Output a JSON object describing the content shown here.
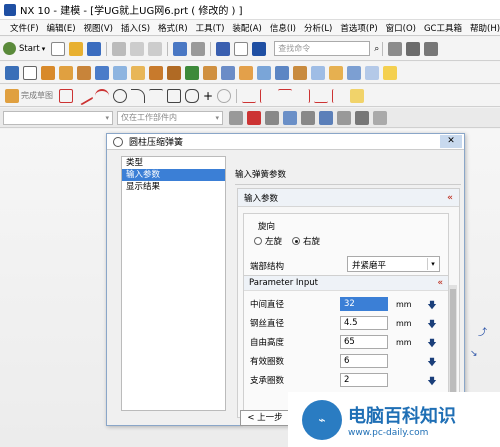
{
  "window": {
    "title": "NX 10 - 建模 - [学UG就上UG网6.prt  ( 修改的 ) ]"
  },
  "menu": {
    "items": [
      "文件(F)",
      "编辑(E)",
      "视图(V)",
      "插入(S)",
      "格式(R)",
      "工具(T)",
      "装配(A)",
      "信息(I)",
      "分析(L)",
      "首选项(P)",
      "窗口(O)",
      "GC工具箱",
      "帮助(H)"
    ]
  },
  "toolbar": {
    "start_label": "Start",
    "search_placeholder": "查找命令",
    "sketch_label": "完成草图",
    "filter_placeholder": "仅在工作部件内"
  },
  "dialog": {
    "title": "圆柱压缩弹簧",
    "nav_items": [
      "类型",
      "输入参数",
      "显示结果"
    ],
    "selected_nav": 1,
    "panel_title": "输入弹簧参数",
    "section_title": "输入参数",
    "direction_label": "旋向",
    "radio_left": "左旋",
    "radio_right": "右旋",
    "radio_selected": "右旋",
    "end_structure_label": "端部结构",
    "end_structure_value": "并紧磨平",
    "param_section": "Parameter Input",
    "params": [
      {
        "label": "中间直径",
        "value": "32",
        "unit": "mm"
      },
      {
        "label": "钢丝直径",
        "value": "4.5",
        "unit": "mm"
      },
      {
        "label": "自由高度",
        "value": "65",
        "unit": "mm"
      },
      {
        "label": "有效圈数",
        "value": "6",
        "unit": ""
      },
      {
        "label": "支承圈数",
        "value": "2",
        "unit": ""
      }
    ],
    "prev_button": "< 上一步"
  },
  "watermark": {
    "cn": "电脑百科知识",
    "url": "www.pc-daily.com"
  },
  "colors": {
    "accent": "#3b7fd6",
    "section_chevron": "#c0392b"
  }
}
